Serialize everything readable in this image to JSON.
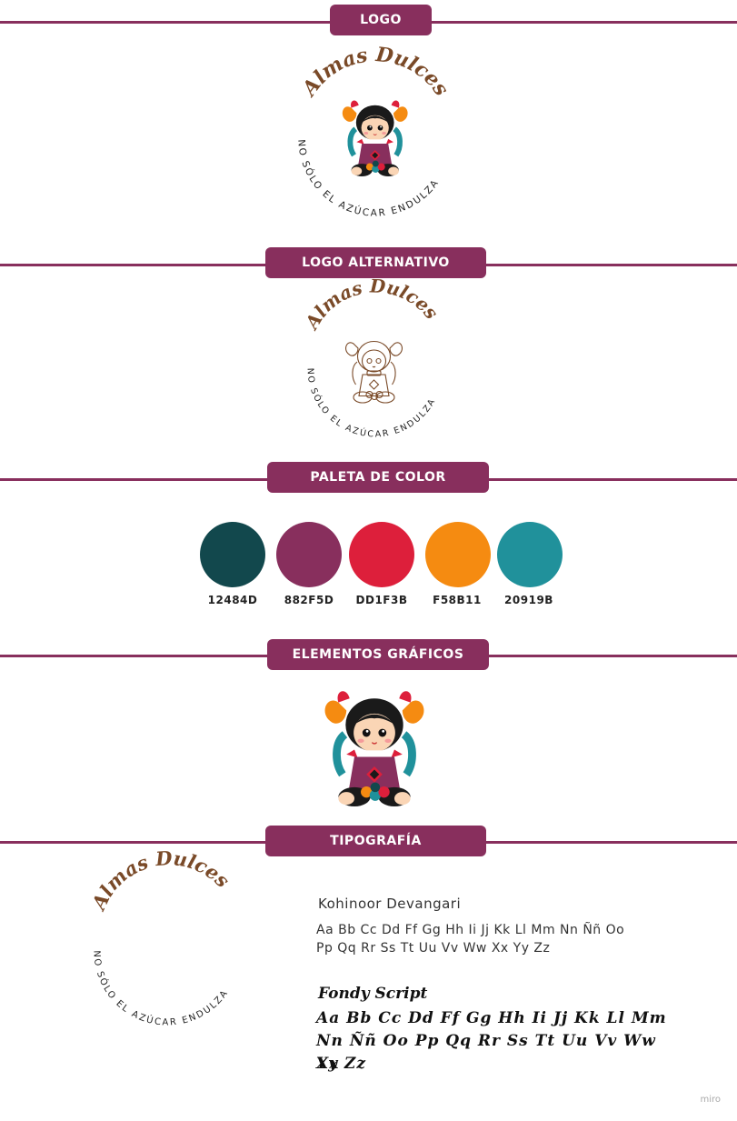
{
  "sections": {
    "logo": {
      "title": "LOGO"
    },
    "logo_alt": {
      "title": "LOGO ALTERNATIVO"
    },
    "palette": {
      "title": "PALETA DE COLOR"
    },
    "graphics": {
      "title": "ELEMENTOS GRÁFICOS"
    },
    "typography": {
      "title": "TIPOGRAFÍA"
    }
  },
  "brand": {
    "name": "Almas Dulces",
    "tagline": "NO SÓLO EL AZÚCAR ENDULZA"
  },
  "palette": [
    {
      "label": "12484D",
      "color": "#12484D"
    },
    {
      "label": "882F5D",
      "color": "#882F5D"
    },
    {
      "label": "DD1F3B",
      "color": "#DD1F3B"
    },
    {
      "label": "F58B11",
      "color": "#F58B11"
    },
    {
      "label": "20919B",
      "color": "#20919B"
    }
  ],
  "typography": {
    "font1_name": "Kohinoor Devangari",
    "font1_line1": "Aa Bb Cc Dd Ff Gg Hh Ii Jj Kk Ll Mm Nn Ññ Oo",
    "font1_line2": "Pp Qq Rr Ss Tt Uu Vv Ww Xx Yy Zz",
    "font2_name": "Fondy Script",
    "font2_line1": "Aa Bb Cc Dd Ff Gg Hh Ii Jj Kk Ll Mm",
    "font2_line2": "Nn Ññ Oo Pp Qq Rr Ss Tt Uu Vv Ww Xx",
    "font2_line3": "Yy Zz"
  },
  "watermark": "miro",
  "icons": {
    "doll": "doll-illustration"
  }
}
